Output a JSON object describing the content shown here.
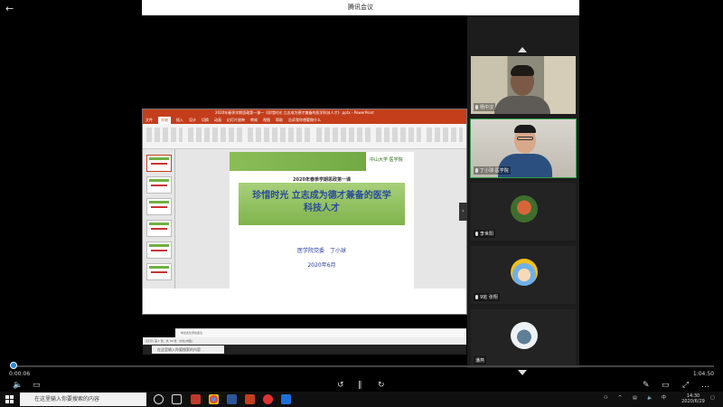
{
  "window": {
    "title": "腾讯会议",
    "back_glyph": "←"
  },
  "powerpoint": {
    "title_text": "2020年春季学期思政第一课—《珍惜时光 立志成为德才兼备的医学科技人才》.pptx - PowerPoint",
    "tabs": [
      "文件",
      "开始",
      "插入",
      "设计",
      "切换",
      "动画",
      "幻灯片放映",
      "审阅",
      "视图",
      "帮助",
      "告诉我你想要做什么"
    ],
    "notes_placeholder": "单击此处添加备注",
    "status_text": "幻灯片 第 1 张，共 30 张　中文(中国)",
    "slide": {
      "logo": "中山大学 医学院",
      "subtitle": "2020年春季学期思政第一课",
      "title_line1": "珍惜时光  立志成为德才兼备的医学",
      "title_line2": "科技人才",
      "author": "医学院党委　丁小球",
      "date": "2020年6月"
    },
    "inner_search_placeholder": "在这里输入你要搜索的内容"
  },
  "participants": [
    {
      "name": "杨中汉",
      "has_video": true
    },
    {
      "name": "丁小球-医学院",
      "has_video": true,
      "active": true
    },
    {
      "name": "李世阳",
      "has_video": false
    },
    {
      "name": "9班 张翔",
      "has_video": false
    },
    {
      "name": "潘燕",
      "has_video": false
    }
  ],
  "player": {
    "elapsed": "0:00:06",
    "total": "1:04:50",
    "progress": 0.002
  },
  "taskbar": {
    "search_placeholder": "在这里输入你要搜索的内容",
    "time": "14:30",
    "date": "2020/6/29"
  },
  "colors": {
    "accent": "#1e88e5",
    "ppt_red": "#c43e1c",
    "slide_green": "#7fb34c",
    "active_border": "#2da04a"
  }
}
